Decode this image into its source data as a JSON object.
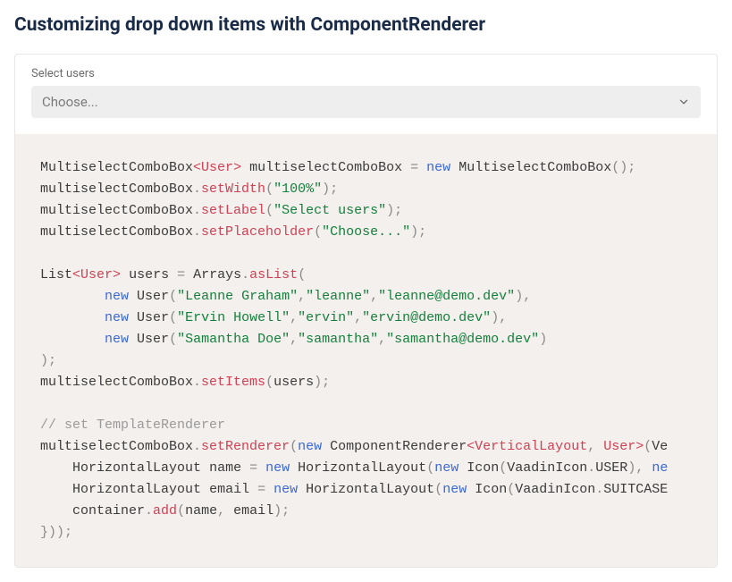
{
  "page": {
    "title": "Customizing drop down items with ComponentRenderer"
  },
  "form": {
    "label": "Select users",
    "placeholder": "Choose..."
  },
  "code": {
    "multiselectType": "MultiselectComboBox",
    "genericUser": "User",
    "varCombo": "multiselectComboBox",
    "newKw": "new",
    "setWidth": "setWidth",
    "widthVal": "\"100%\"",
    "setLabel": "setLabel",
    "labelVal": "\"Select users\"",
    "setPlaceholder": "setPlaceholder",
    "placeholderVal": "\"Choose...\"",
    "listType": "List",
    "usersVar": "users",
    "arraysClass": "Arrays",
    "asList": "asList",
    "userClass": "User",
    "u1a": "\"Leanne Graham\"",
    "u1b": "\"leanne\"",
    "u1c": "\"leanne@demo.dev\"",
    "u2a": "\"Ervin Howell\"",
    "u2b": "\"ervin\"",
    "u2c": "\"ervin@demo.dev\"",
    "u3a": "\"Samantha Doe\"",
    "u3b": "\"samantha\"",
    "u3c": "\"samantha@demo.dev\"",
    "setItems": "setItems",
    "comment": "// set TemplateRenderer",
    "setRenderer": "setRenderer",
    "componentRenderer": "ComponentRenderer",
    "verticalLayout": "VerticalLayout",
    "horizLayout": "HorizontalLayout",
    "nameVar": "name",
    "emailVar": "email",
    "iconClass": "Icon",
    "vaadinIcon": "VaadinIcon",
    "iconUser": "USER",
    "iconSuitcase": "SUITCASE",
    "containerVar": "container",
    "addMethod": "add",
    "openParen": "(",
    "closeParen": ")",
    "openAngle": "<",
    "closeAngle": ">",
    "comma": ",",
    "semi": ";",
    "dot": ".",
    "eq": "=",
    "closeBrace": "}",
    "closeBrParSemi": "));",
    "ve": "Ve",
    "ne": "ne"
  }
}
